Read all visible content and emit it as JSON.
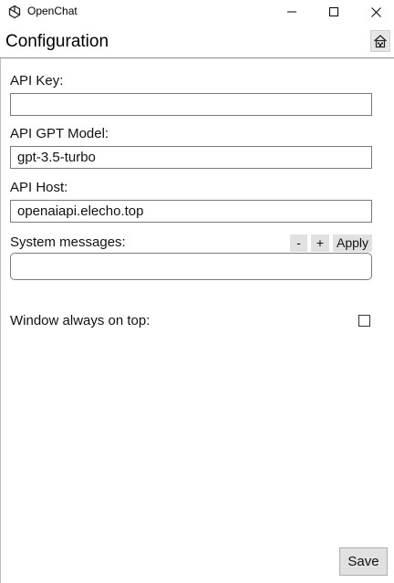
{
  "window": {
    "title": "OpenChat",
    "controls": [
      "minimize",
      "maximize",
      "close"
    ]
  },
  "header": {
    "title": "Configuration",
    "home_icon": "home-icon"
  },
  "form": {
    "api_key": {
      "label": "API Key:",
      "value": "",
      "placeholder": ""
    },
    "api_gpt_model": {
      "label": "API GPT Model:",
      "value": "gpt-3.5-turbo"
    },
    "api_host": {
      "label": "API Host:",
      "value": "openaiapi.elecho.top"
    },
    "system_messages": {
      "label": "System messages:",
      "remove_label": "-",
      "add_label": "+",
      "apply_label": "Apply",
      "value": ""
    },
    "always_on_top": {
      "label": "Window always on top:",
      "checked": false
    }
  },
  "footer": {
    "save_label": "Save"
  }
}
